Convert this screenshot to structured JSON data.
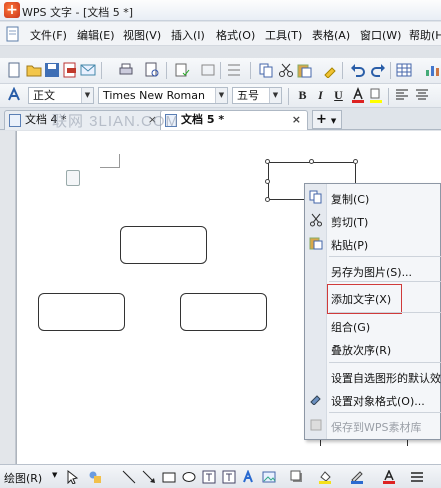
{
  "window": {
    "title": "WPS 文字 - [文档 5 *]",
    "logo_char": "+"
  },
  "menu": {
    "items": [
      "文件(F)",
      "编辑(E)",
      "视图(V)",
      "插入(I)",
      "格式(O)",
      "工具(T)",
      "表格(A)",
      "窗口(W)",
      "帮助(H)"
    ]
  },
  "format_bar": {
    "style_value": "正文",
    "font_value": "Times New Roman",
    "size_value": "五号",
    "bold": "B",
    "italic": "I",
    "underline": "U"
  },
  "tabs": [
    {
      "label": "文档 4 *",
      "close": "×"
    },
    {
      "label": "文档 5 *",
      "close": "×"
    }
  ],
  "tab_new": "+",
  "watermark": "联网 3LIAN.COM",
  "context_menu": {
    "items": [
      "复制(C)",
      "剪切(T)",
      "粘贴(P)",
      "另存为图片(S)...",
      "添加文字(X)",
      "组合(G)",
      "叠放次序(R)",
      "设置自选图形的默认效果",
      "设置对象格式(O)...",
      "保存到WPS素材库"
    ]
  },
  "draw_bar": {
    "label": "绘图(R)"
  },
  "colors": {
    "accent": "#2b5fa8",
    "highlight_border": "#d03a3a",
    "page": "#ffffff"
  }
}
